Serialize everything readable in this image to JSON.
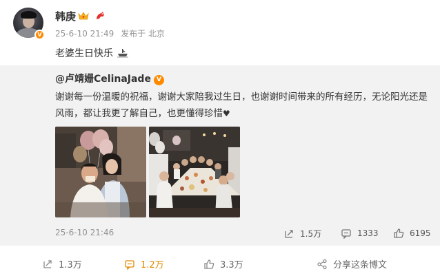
{
  "post": {
    "username": "韩庚",
    "time": "25-6-10 21:49",
    "location": "发布于 北京",
    "text": "老婆生日快乐",
    "icons": [
      "crown-icon",
      "dragon-icon",
      "verified-icon",
      "ship-emoji-icon"
    ]
  },
  "repost": {
    "username": "@卢靖姗CelinaJade",
    "text": "谢谢每一份温暖的祝福，谢谢大家陪我过生日，也谢谢时间带来的所有经历，无论阳光还是风雨，都让我更了解自己，也更懂得珍惜",
    "heart": "♥",
    "time": "25-6-10 21:46",
    "reposts": "1.5万",
    "comments": "1333",
    "likes": "6195"
  },
  "actions": {
    "repost": "1.3万",
    "comment": "1.2万",
    "like": "3.3万",
    "share": "分享这条博文"
  },
  "colors": {
    "accent": "#ff8a00",
    "comment_active": "#e08a00",
    "meta": "#939393",
    "repost_bg": "#f2f2f2"
  }
}
